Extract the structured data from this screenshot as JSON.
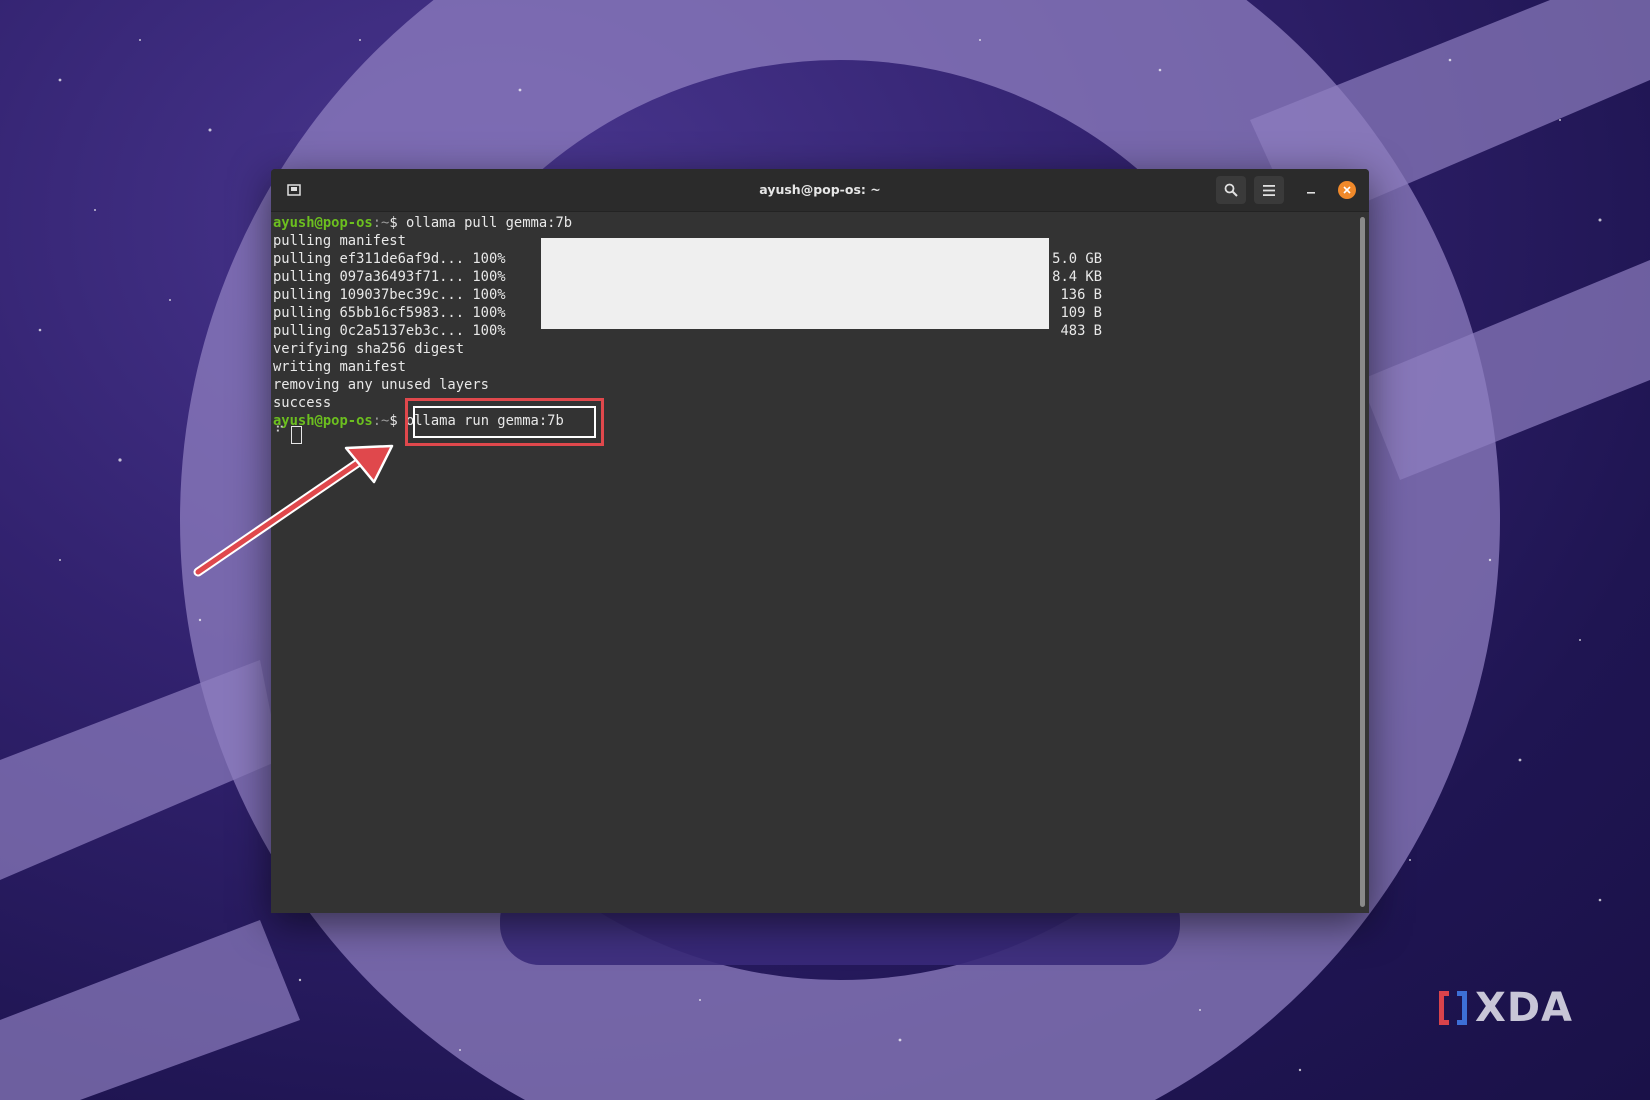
{
  "window": {
    "title": "ayush@pop-os: ~"
  },
  "terminal": {
    "prompt_user": "ayush@pop-os",
    "prompt_sep": ":~",
    "prompt_dollar": "$ ",
    "command_1": "ollama pull gemma:7b",
    "output_lines": [
      "pulling manifest",
      "pulling ef311de6af9d... 100%",
      "pulling 097a36493f71... 100%",
      "pulling 109037bec39c... 100%",
      "pulling 65bb16cf5983... 100%",
      "pulling 0c2a5137eb3c... 100%",
      "verifying sha256 digest",
      "writing manifest",
      "removing any unused layers",
      "success"
    ],
    "sizes": [
      "5.0 GB",
      "8.4 KB",
      "136 B",
      "109 B",
      "483 B"
    ],
    "command_2": "ollama run gemma:7b",
    "spinner": "⠋"
  },
  "watermark": {
    "text": "XDA"
  },
  "colors": {
    "prompt_user": "#6cbf1f",
    "annotation": "#e0484c",
    "close_button": "#f0892a"
  }
}
